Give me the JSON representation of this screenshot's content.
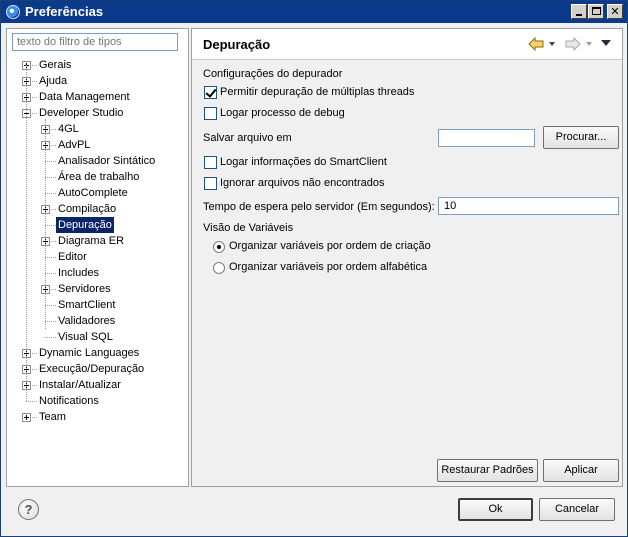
{
  "window": {
    "title": "Preferências"
  },
  "filter": {
    "placeholder": "texto do filtro de tipos"
  },
  "tree": [
    {
      "label": "Gerais",
      "expander": "plus"
    },
    {
      "label": "Ajuda",
      "expander": "plus"
    },
    {
      "label": "Data Management",
      "expander": "plus"
    },
    {
      "label": "Developer Studio",
      "expander": "minus"
    },
    {
      "label": "4GL",
      "expander": "plus"
    },
    {
      "label": "AdvPL",
      "expander": "plus"
    },
    {
      "label": "Analisador Sintático",
      "expander": "none"
    },
    {
      "label": "Área de trabalho",
      "expander": "none"
    },
    {
      "label": "AutoComplete",
      "expander": "none"
    },
    {
      "label": "Compilação",
      "expander": "plus"
    },
    {
      "label": "Depuração",
      "expander": "none",
      "selected": true
    },
    {
      "label": "Diagrama ER",
      "expander": "plus"
    },
    {
      "label": "Editor",
      "expander": "none"
    },
    {
      "label": "Includes",
      "expander": "none"
    },
    {
      "label": "Servidores",
      "expander": "plus"
    },
    {
      "label": "SmartClient",
      "expander": "none"
    },
    {
      "label": "Validadores",
      "expander": "none"
    },
    {
      "label": "Visual SQL",
      "expander": "none"
    },
    {
      "label": "Dynamic Languages",
      "expander": "plus"
    },
    {
      "label": "Execução/Depuração",
      "expander": "plus"
    },
    {
      "label": "Instalar/Atualizar",
      "expander": "plus"
    },
    {
      "label": "Notifications",
      "expander": "none"
    },
    {
      "label": "Team",
      "expander": "plus"
    }
  ],
  "page": {
    "title": "Depuração",
    "section_debugger": "Configurações do depurador",
    "multi_threads": {
      "label": "Permitir depuração de múltiplas threads",
      "checked": true
    },
    "log_debug": {
      "label": "Logar processo de debug",
      "checked": false
    },
    "save_file": {
      "label": "Salvar arquivo em",
      "value": "",
      "browse_label": "Procurar..."
    },
    "log_smartclient": {
      "label": "Logar informações do SmartClient",
      "checked": false
    },
    "ignore_missing": {
      "label": "Ignorar arquivos não encontrados",
      "checked": false
    },
    "timeout": {
      "label": "Tempo de espera pelo servidor (Em segundos):",
      "value": "10"
    },
    "section_vars": "Visão de Variáveis",
    "order_creation": {
      "label": "Organizar variáveis por ordem de criação",
      "selected": true
    },
    "order_alpha": {
      "label": "Organizar variáveis por ordem alfabética",
      "selected": false
    },
    "restore_label": "Restaurar Padrões",
    "apply_label": "Aplicar"
  },
  "footer": {
    "help": "?",
    "ok_label": "Ok",
    "cancel_label": "Cancelar"
  }
}
